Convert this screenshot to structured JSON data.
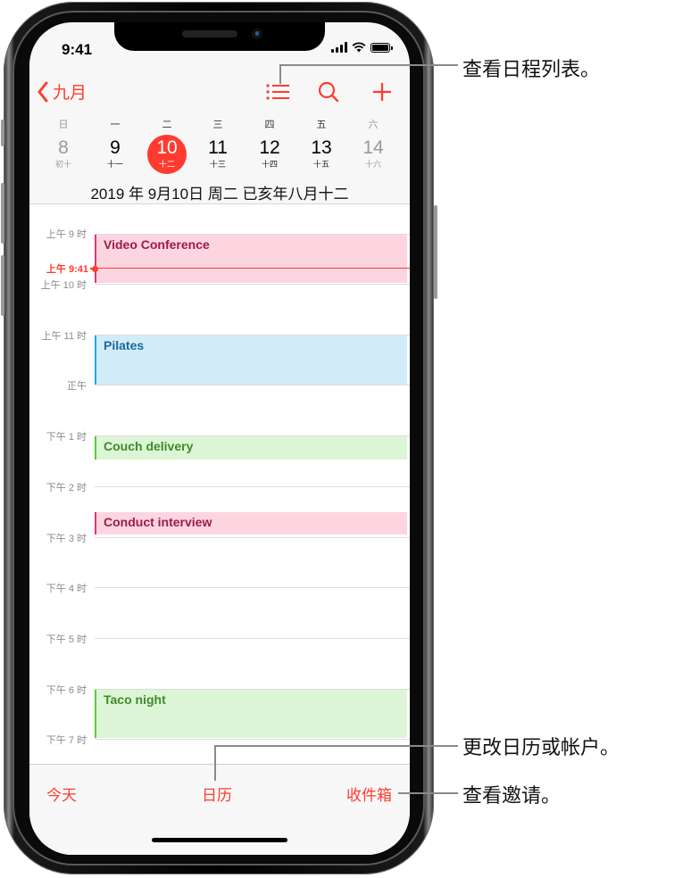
{
  "status_bar": {
    "time": "9:41"
  },
  "nav": {
    "back_label": "九月",
    "icons": [
      "back-chevron-icon",
      "list-icon",
      "search-icon",
      "add-icon"
    ]
  },
  "week": {
    "weekdays": [
      "日",
      "一",
      "二",
      "三",
      "四",
      "五",
      "六"
    ],
    "days": [
      {
        "num": "8",
        "lunar": "初十",
        "state": "dim"
      },
      {
        "num": "9",
        "lunar": "十一",
        "state": "normal"
      },
      {
        "num": "10",
        "lunar": "十二",
        "state": "selected"
      },
      {
        "num": "11",
        "lunar": "十三",
        "state": "normal"
      },
      {
        "num": "12",
        "lunar": "十四",
        "state": "normal"
      },
      {
        "num": "13",
        "lunar": "十五",
        "state": "normal"
      },
      {
        "num": "14",
        "lunar": "十六",
        "state": "dim"
      }
    ],
    "full_date": "2019 年 9月10日 周二  已亥年八月十二"
  },
  "timeline": {
    "hours": [
      "上午 9 时",
      "上午 10 时",
      "上午 11 时",
      "正午",
      "下午 1 时",
      "下午 2 时",
      "下午 3 时",
      "下午 4 时",
      "下午 5 时",
      "下午 6 时",
      "下午 7 时"
    ],
    "now_label": "上午 9:41",
    "events": [
      {
        "title": "Video Conference",
        "color": "pink"
      },
      {
        "title": "Pilates",
        "color": "blue"
      },
      {
        "title": "Couch delivery",
        "color": "green"
      },
      {
        "title": "Conduct interview",
        "color": "pink"
      },
      {
        "title": "Taco night",
        "color": "green"
      }
    ]
  },
  "tabbar": {
    "today": "今天",
    "calendars": "日历",
    "inbox": "收件箱"
  },
  "callouts": {
    "list": "查看日程列表。",
    "calendars": "更改日历或帐户。",
    "inbox": "查看邀请。"
  },
  "colors": {
    "accent": "#ff3b30",
    "pink_bg": "#fdd5e0",
    "pink_bar": "#e8336b",
    "pink_text": "#9a1c48",
    "blue_bg": "#d2ebf9",
    "blue_bar": "#1ba7ef",
    "blue_text": "#1a6a9a",
    "green_bg": "#dcf5d6",
    "green_bar": "#55cc3a",
    "green_text": "#3f8a2a"
  }
}
